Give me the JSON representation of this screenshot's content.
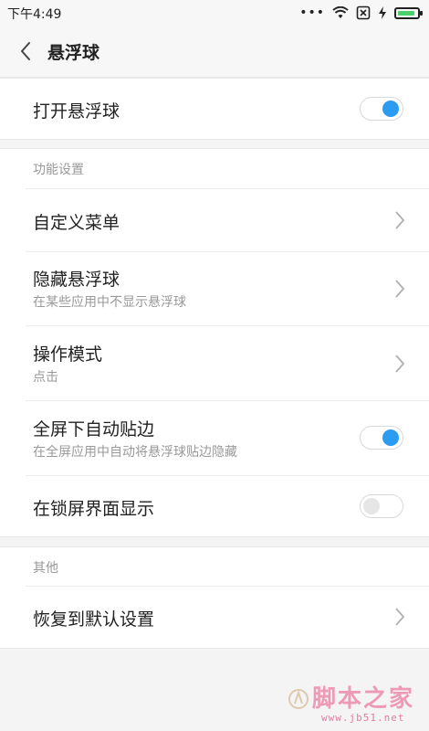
{
  "status": {
    "time": "下午4:49"
  },
  "header": {
    "title": "悬浮球"
  },
  "main_toggle": {
    "label": "打开悬浮球",
    "enabled": true
  },
  "section_function": {
    "title": "功能设置",
    "custom_menu": {
      "label": "自定义菜单"
    },
    "hide_ball": {
      "label": "隐藏悬浮球",
      "subtitle": "在某些应用中不显示悬浮球"
    },
    "operation_mode": {
      "label": "操作模式",
      "subtitle": "点击"
    },
    "fullscreen_edge": {
      "label": "全屏下自动贴边",
      "subtitle": "在全屏应用中自动将悬浮球贴边隐藏",
      "enabled": true
    },
    "lockscreen_show": {
      "label": "在锁屏界面显示",
      "enabled": false
    }
  },
  "section_other": {
    "title": "其他",
    "restore_default": {
      "label": "恢复到默认设置"
    }
  },
  "watermark": {
    "text": "脚本之家",
    "url": "www.jb51.net"
  },
  "colors": {
    "accent": "#2c9cf2",
    "battery": "#4bd16b"
  }
}
